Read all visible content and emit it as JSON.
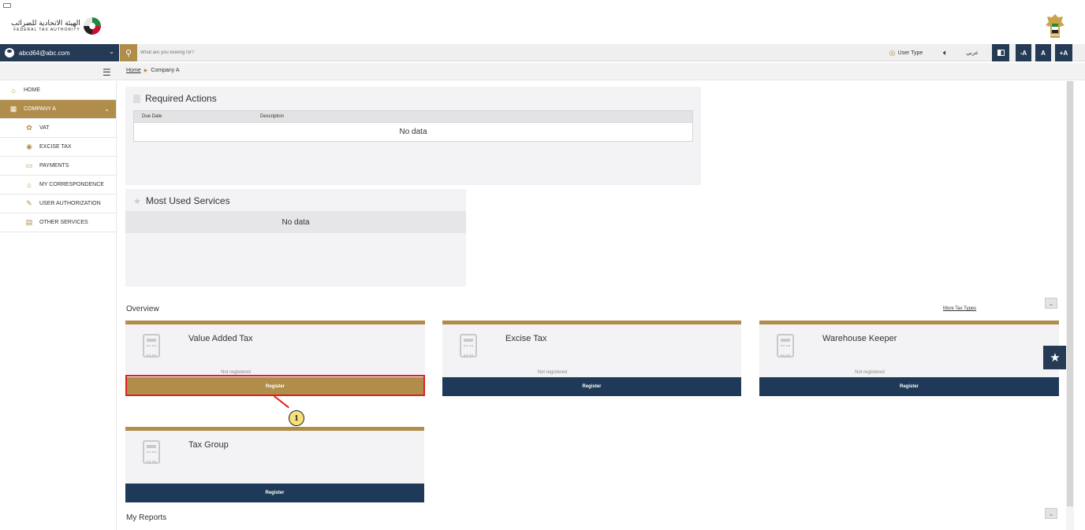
{
  "header": {
    "logo_arabic": "الهيئة الاتحادية للضرائب",
    "logo_english": "FEDERAL TAX AUTHORITY"
  },
  "topbar": {
    "user_email": "abcd64@abc.com",
    "search_placeholder": "What are you looking for?",
    "user_type_label": "User Type",
    "language_label": "عربي",
    "font_decrease": "-A",
    "font_normal": "A",
    "font_increase": "+A"
  },
  "breadcrumb": {
    "home": "Home",
    "current": "Company A"
  },
  "sidebar": {
    "items": [
      {
        "label": "HOME",
        "icon": "home-icon"
      },
      {
        "label": "COMPANY A",
        "icon": "grid-icon"
      },
      {
        "label": "VAT",
        "icon": "vat-icon"
      },
      {
        "label": "EXCISE TAX",
        "icon": "excise-icon"
      },
      {
        "label": "PAYMENTS",
        "icon": "payments-icon"
      },
      {
        "label": "MY CORRESPONDENCE",
        "icon": "correspondence-icon"
      },
      {
        "label": "USER AUTHORIZATION",
        "icon": "user-auth-icon"
      },
      {
        "label": "OTHER SERVICES",
        "icon": "other-services-icon"
      }
    ]
  },
  "required_actions": {
    "title": "Required Actions",
    "col_due_date": "Due Date",
    "col_description": "Description",
    "empty": "No data"
  },
  "most_used": {
    "title": "Most Used Services",
    "empty": "No data"
  },
  "overview": {
    "title": "Overview",
    "more_link": "More Tax Types",
    "cards": [
      {
        "title": "Value Added Tax",
        "status": "Not registered",
        "button": "Register"
      },
      {
        "title": "Excise Tax",
        "status": "Not registered",
        "button": "Register"
      },
      {
        "title": "Warehouse Keeper",
        "status": "Not registered",
        "button": "Register"
      },
      {
        "title": "Tax Group",
        "status": "",
        "button": "Register"
      }
    ]
  },
  "callout_number": "1",
  "reports": {
    "title": "My Reports"
  },
  "colors": {
    "gold": "#b08d4a",
    "navy": "#1f3a58",
    "highlight_red": "#e02020"
  }
}
